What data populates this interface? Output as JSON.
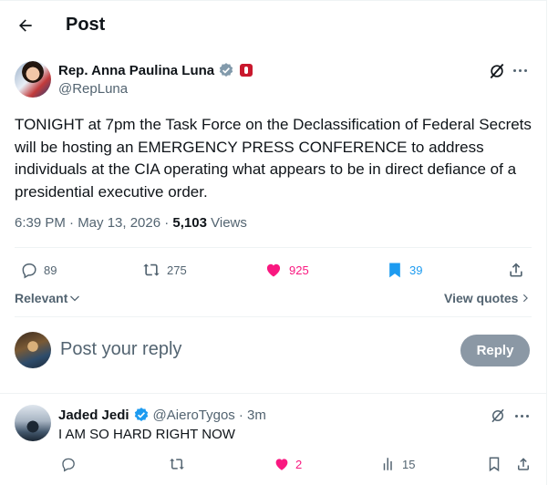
{
  "header": {
    "title": "Post"
  },
  "post": {
    "author_name": "Rep. Anna Paulina Luna",
    "author_handle": "@RepLuna",
    "text": "TONIGHT at 7pm the Task Force on the Declassification of Federal Secrets will be hosting an EMERGENCY PRESS CONFERENCE to address individuals at the CIA operating what appears to be in direct defiance of a presidential executive order.",
    "time": "6:39 PM · May 13, 2026 ·",
    "views_count": "5,103",
    "views_label": "Views",
    "replies": "89",
    "reposts": "275",
    "likes": "925",
    "bookmarks": "39"
  },
  "sort": {
    "label": "Relevant",
    "view_quotes": "View quotes"
  },
  "composer": {
    "placeholder": "Post your reply",
    "button": "Reply"
  },
  "comment": {
    "author_name": "Jaded Jedi",
    "author_handle": "@AieroTygos",
    "time": "· 3m",
    "text": "I AM SO HARD RIGHT NOW",
    "likes": "2",
    "views": "15"
  },
  "colors": {
    "like": "#f91880",
    "bookmark": "#1d9bf0",
    "verified": "#1d9bf0",
    "reply_button": "#8b98a5"
  }
}
